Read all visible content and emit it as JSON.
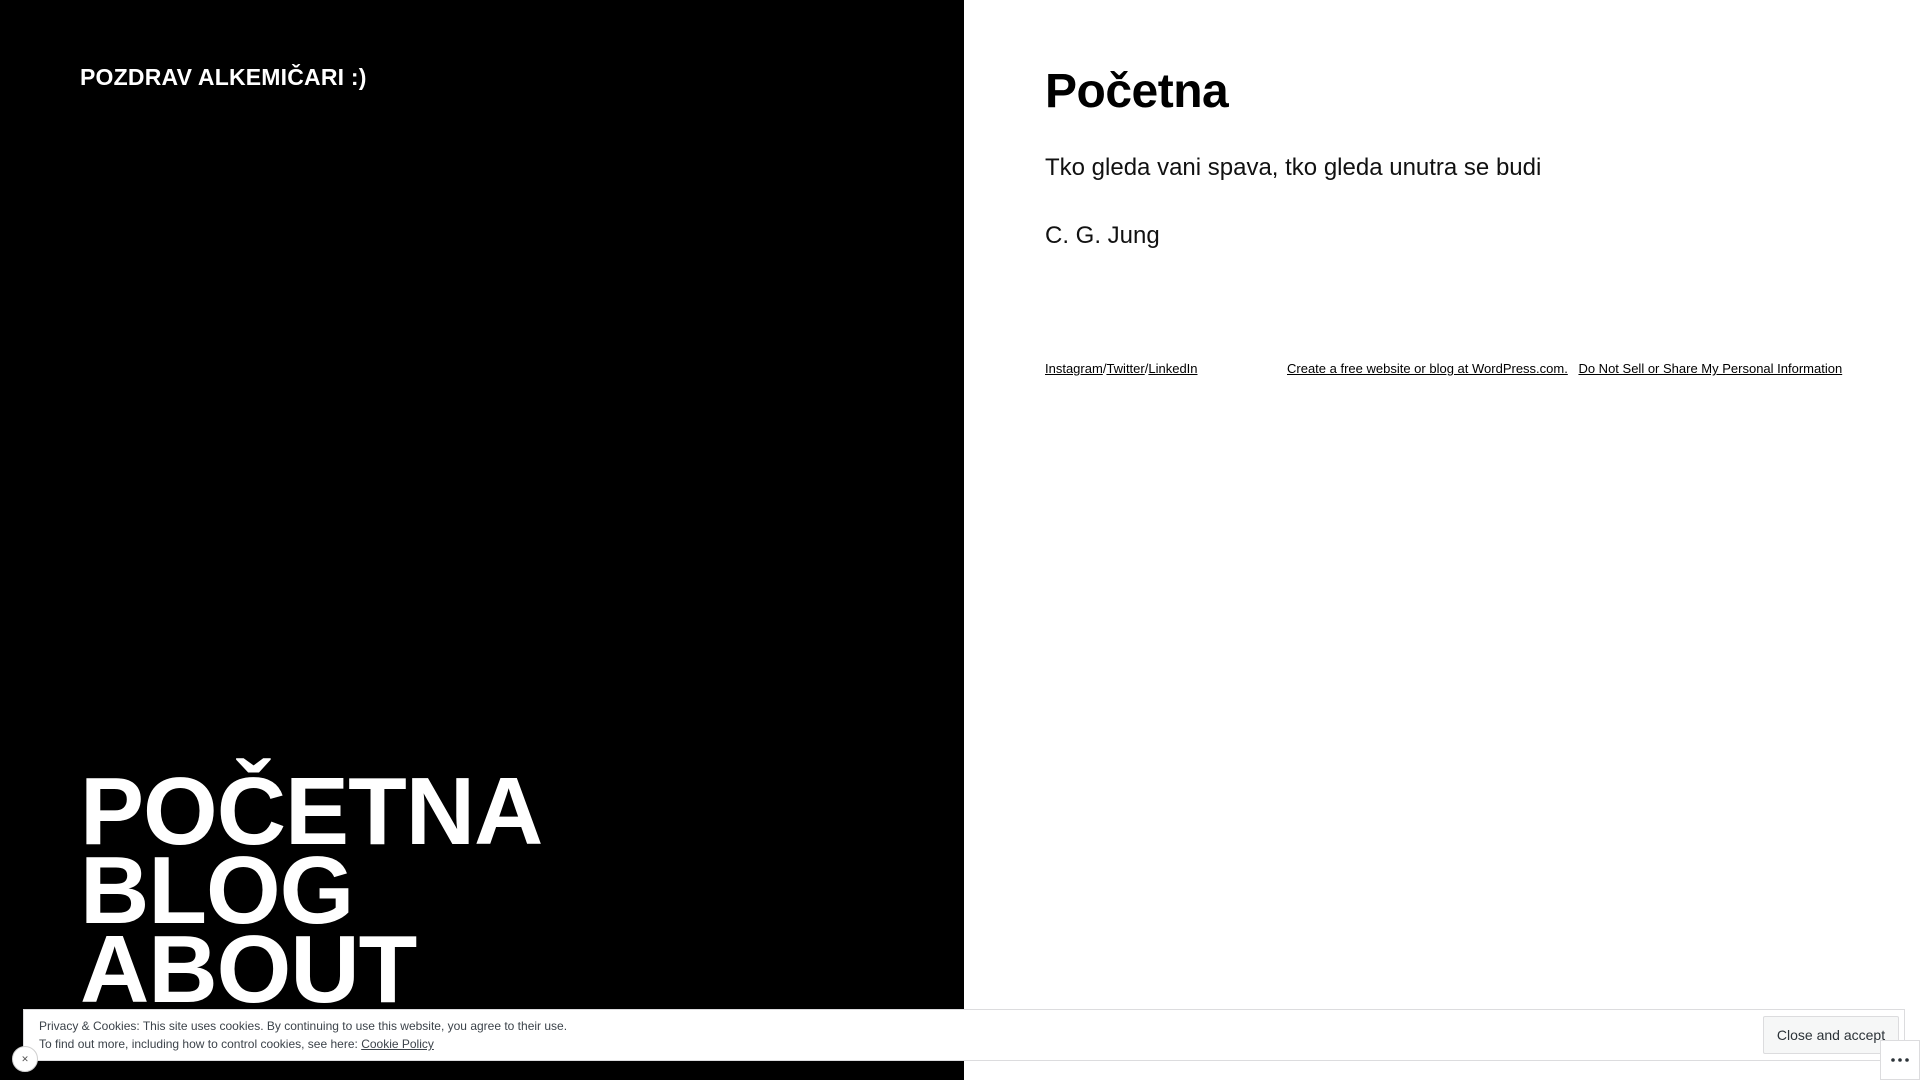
{
  "site": {
    "title": "POZDRAV ALKEMIČARI :)"
  },
  "nav": {
    "items": [
      "POČETNA",
      "BLOG",
      "ABOUT"
    ]
  },
  "content": {
    "heading": "Početna",
    "quote": "Tko gleda vani spava, tko gleda unutra se budi",
    "author": "C. G. Jung"
  },
  "footer": {
    "social": {
      "instagram": "Instagram",
      "twitter": "Twitter",
      "linkedin": "LinkedIn",
      "separator": "/"
    },
    "wordpress_link": "Create a free website or blog at WordPress.com.",
    "privacy_link": "Do Not Sell or Share My Personal Information"
  },
  "cookie_banner": {
    "line1": "Privacy & Cookies: This site uses cookies. By continuing to use this website, you agree to their use.",
    "line2_prefix": "To find out more, including how to control cookies, see here: ",
    "policy_link": "Cookie Policy",
    "button": "Close and accept"
  },
  "icons": {
    "more_menu": "ellipsis-icon",
    "dismiss": "close-icon"
  },
  "colors": {
    "left_panel": "#000000",
    "right_panel": "#ffffff"
  }
}
